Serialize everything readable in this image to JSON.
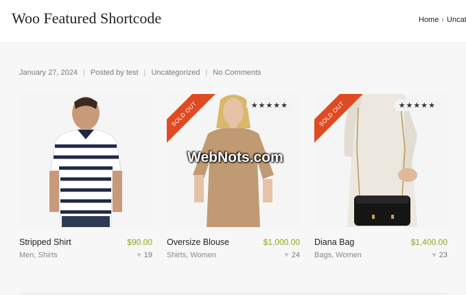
{
  "site": {
    "title": "Woo Featured Shortcode"
  },
  "breadcrumb": {
    "home": "Home",
    "current": "Uncate"
  },
  "post_meta": {
    "date": "January 27, 2024",
    "author": "Posted by test",
    "category": "Uncategorized",
    "comments": "No Comments"
  },
  "products": [
    {
      "name": "Stripped Shirt",
      "price": "$90.00",
      "categories": "Men, Shirts",
      "likes": "19",
      "badge": "",
      "rating": ""
    },
    {
      "name": "Oversize Blouse",
      "price": "$1,000.00",
      "categories": "Shirts, Women",
      "likes": "24",
      "badge": "SOLD OUT",
      "rating": "★★★★★"
    },
    {
      "name": "Diana Bag",
      "price": "$1,400.00",
      "categories": "Bags, Women",
      "likes": "23",
      "badge": "SOLD OUT",
      "rating": "★★★★★"
    }
  ],
  "watermark": "WebNots.com",
  "colors": {
    "price": "#88aa13",
    "ribbon": "#e04a23"
  }
}
